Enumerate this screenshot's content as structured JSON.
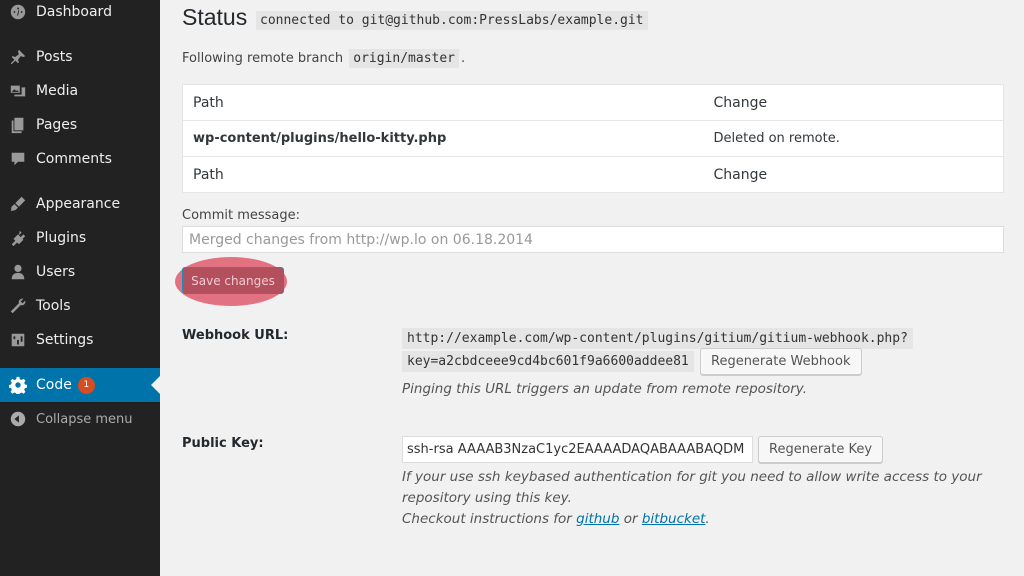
{
  "sidebar": {
    "items": [
      {
        "label": "Dashboard",
        "icon": "dashboard-icon"
      },
      {
        "label": "Posts",
        "icon": "pin-icon"
      },
      {
        "label": "Media",
        "icon": "media-icon"
      },
      {
        "label": "Pages",
        "icon": "pages-icon"
      },
      {
        "label": "Comments",
        "icon": "comment-icon"
      },
      {
        "label": "Appearance",
        "icon": "brush-icon"
      },
      {
        "label": "Plugins",
        "icon": "plug-icon"
      },
      {
        "label": "Users",
        "icon": "user-icon"
      },
      {
        "label": "Tools",
        "icon": "wrench-icon"
      },
      {
        "label": "Settings",
        "icon": "settings-icon"
      },
      {
        "label": "Code",
        "icon": "gear-icon",
        "badge": "1",
        "active": true
      }
    ],
    "collapse_label": "Collapse menu",
    "active_color": "#0073aa"
  },
  "status": {
    "title": "Status",
    "connection": "connected to git@github.com:PressLabs/example.git",
    "following_prefix": "Following remote branch",
    "branch": "origin/master",
    "following_suffix": "."
  },
  "changes_table": {
    "header": {
      "path": "Path",
      "change": "Change"
    },
    "rows": [
      {
        "path": "wp-content/plugins/hello-kitty.php",
        "change": "Deleted on remote."
      }
    ],
    "footer": {
      "path": "Path",
      "change": "Change"
    }
  },
  "commit": {
    "label": "Commit message:",
    "placeholder": "Merged changes from http://wp.lo on 06.18.2014"
  },
  "save_button": "Save changes",
  "webhook": {
    "label": "Webhook URL:",
    "url_line1": "http://example.com/wp-content/plugins/gitium/gitium-webhook.php?",
    "url_line2": "key=a2cbdceee9cd4bc601f9a6600addee81",
    "regenerate_label": "Regenerate Webhook",
    "description": "Pinging this URL triggers an update from remote repository."
  },
  "public_key": {
    "label": "Public Key:",
    "value": "ssh-rsa AAAAB3NzaC1yc2EAAAADAQABAAABAQDM",
    "regenerate_label": "Regenerate Key",
    "desc_line1": "If your use ssh keybased authentication for git you need to allow write access to your",
    "desc_line2": "repository using this key.",
    "desc_line3_prefix": "Checkout instructions for",
    "link_github": "github",
    "desc_or": "or",
    "link_bitbucket": "bitbucket",
    "desc_end": "."
  }
}
